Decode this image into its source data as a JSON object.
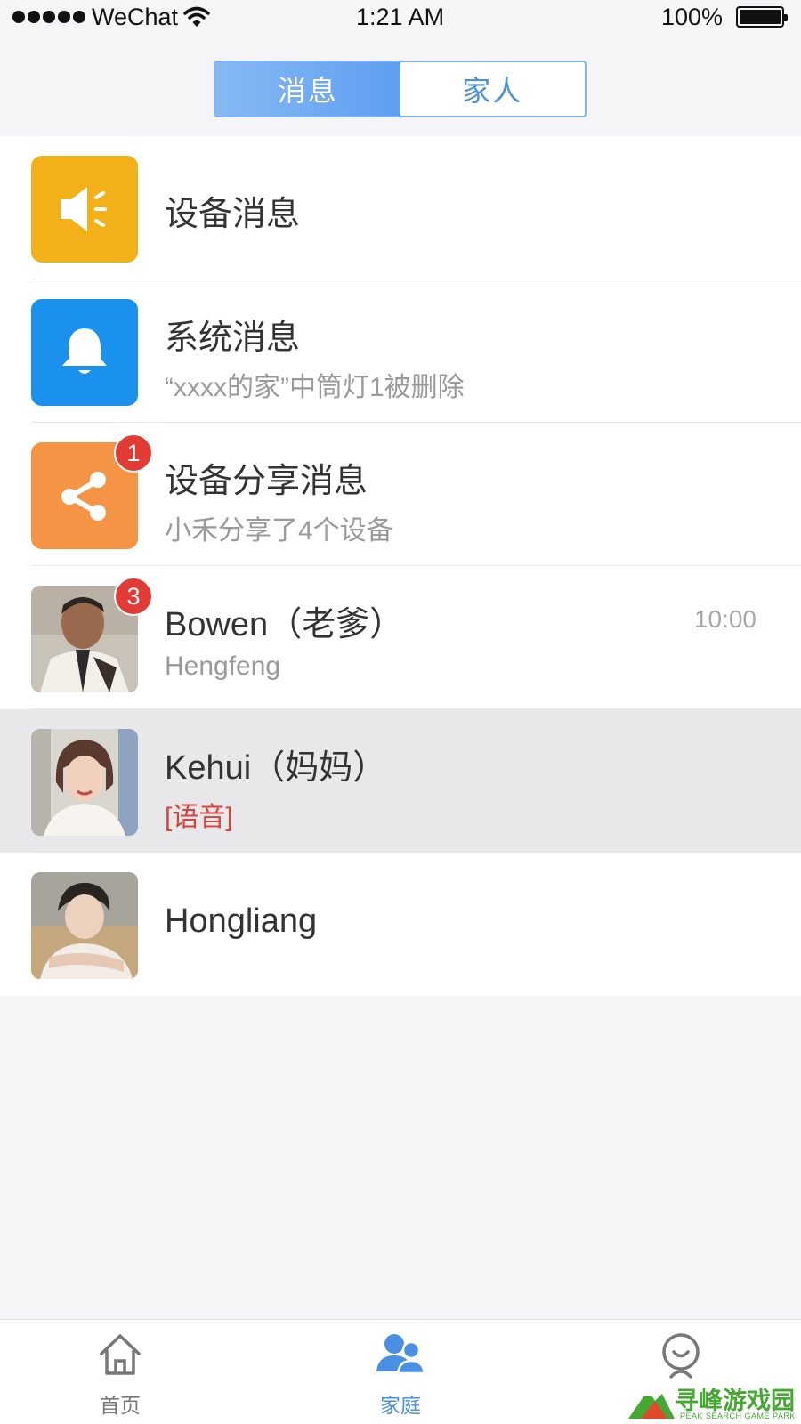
{
  "status_bar": {
    "carrier": "WeChat",
    "time": "1:21 AM",
    "battery": "100%"
  },
  "segment": {
    "tabs": [
      {
        "label": "消息",
        "active": true
      },
      {
        "label": "家人",
        "active": false
      }
    ]
  },
  "list": [
    {
      "type": "device",
      "icon": "speaker-icon",
      "color": "#f2b019",
      "title": "设备消息"
    },
    {
      "type": "system",
      "icon": "bell-icon",
      "color": "#1a91ec",
      "title": "系统消息",
      "subtitle": "“xxxx的家”中筒灯1被删除"
    },
    {
      "type": "share",
      "icon": "share-icon",
      "color": "#f69446",
      "title": "设备分享消息",
      "subtitle": "小禾分享了4个设备",
      "badge": "1"
    },
    {
      "type": "contact",
      "avatar": "avatar-bowen",
      "title": "Bowen（老爹）",
      "subtitle": "Hengfeng",
      "badge": "3",
      "time": "10:00"
    },
    {
      "type": "contact",
      "avatar": "avatar-kehui",
      "title": "Kehui（妈妈）",
      "subtitle": "[语音]",
      "selected": true
    },
    {
      "type": "contact",
      "avatar": "avatar-hongliang",
      "title": "Hongliang"
    }
  ],
  "tab_bar": {
    "items": [
      {
        "label": "首页",
        "icon": "home-icon",
        "active": false
      },
      {
        "label": "家庭",
        "icon": "family-icon",
        "active": true
      },
      {
        "label": "我的",
        "icon": "profile-icon",
        "active": false
      }
    ]
  },
  "watermark": {
    "text": "寻峰游戏园",
    "sub": "PEAK SEARCH GAME PARK"
  },
  "colors": {
    "accent": "#4a90e2",
    "badge": "#e23b35",
    "voice": "#d9423d"
  }
}
